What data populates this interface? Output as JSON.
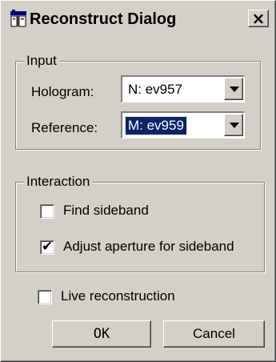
{
  "window": {
    "title": "Reconstruct Dialog",
    "close_glyph": "×"
  },
  "input_group": {
    "title": "Input",
    "hologram_label": "Hologram:",
    "hologram_value": "N: ev957",
    "reference_label": "Reference:",
    "reference_value": "M: ev959"
  },
  "interaction_group": {
    "title": "Interaction",
    "find_sideband": {
      "label": "Find sideband",
      "checked": false
    },
    "adjust_aperture": {
      "label": "Adjust aperture for sideband",
      "checked": true
    }
  },
  "live_reconstruction": {
    "label": "Live reconstruction",
    "checked": false
  },
  "buttons": {
    "ok": "OK",
    "cancel": "Cancel"
  },
  "icons": {
    "app": "dialog-app-icon",
    "check": "✔",
    "dropdown": "chevron-down-icon"
  },
  "colors": {
    "face": "#d4d0c8",
    "selection": "#0a246a"
  }
}
